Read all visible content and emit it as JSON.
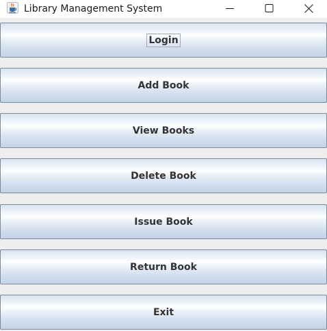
{
  "window": {
    "title": "Library Management System",
    "icon": "java-coffee-cup-icon",
    "controls": {
      "minimize": "minimize-icon",
      "maximize": "maximize-icon",
      "close": "close-icon"
    }
  },
  "buttons": {
    "login": "Login",
    "add_book": "Add Book",
    "view_books": "View Books",
    "delete_book": "Delete Book",
    "issue_book": "Issue Book",
    "return_book": "Return Book",
    "exit": "Exit"
  },
  "focused_button": "Login",
  "colors": {
    "window_background": "#eeeeee",
    "button_border": "#7a8a9a",
    "button_gradient_top": "#d9e4f0",
    "button_gradient_highlight": "#ffffff",
    "button_gradient_bottom": "#c4d4e6",
    "button_text": "#333333"
  }
}
